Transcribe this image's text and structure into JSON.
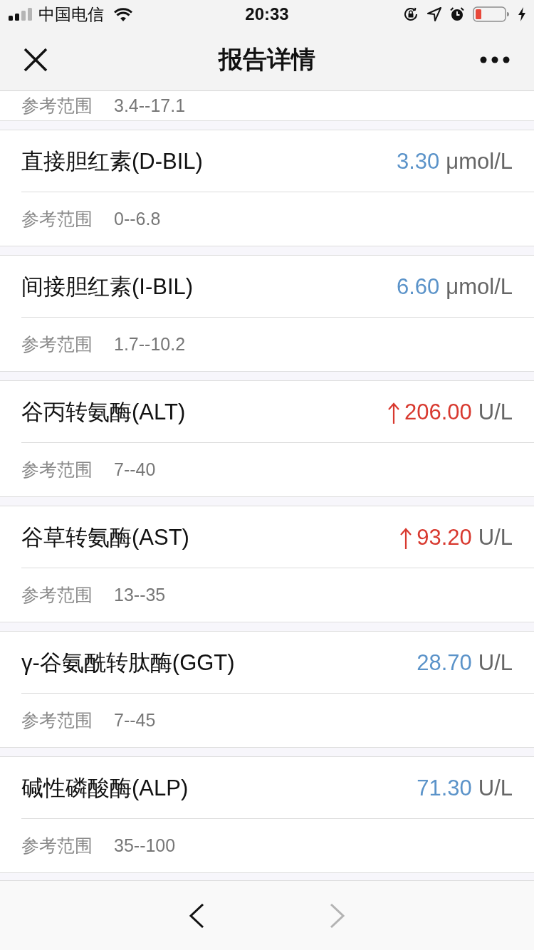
{
  "status_bar": {
    "carrier": "中国电信",
    "time": "20:33"
  },
  "nav": {
    "title": "报告详情"
  },
  "partial_item": {
    "range_label": "参考范围",
    "range": "3.4--17.1"
  },
  "items": [
    {
      "name": "直接胆红素(D-BIL)",
      "value": "3.30",
      "unit": "μmol/L",
      "high": false,
      "range_label": "参考范围",
      "range": "0--6.8"
    },
    {
      "name": "间接胆红素(I-BIL)",
      "value": "6.60",
      "unit": "μmol/L",
      "high": false,
      "range_label": "参考范围",
      "range": "1.7--10.2"
    },
    {
      "name": "谷丙转氨酶(ALT)",
      "value": "206.00",
      "unit": "U/L",
      "high": true,
      "range_label": "参考范围",
      "range": "7--40"
    },
    {
      "name": "谷草转氨酶(AST)",
      "value": "93.20",
      "unit": "U/L",
      "high": true,
      "range_label": "参考范围",
      "range": "13--35"
    },
    {
      "name": "γ-谷氨酰转肽酶(GGT)",
      "value": "28.70",
      "unit": "U/L",
      "high": false,
      "range_label": "参考范围",
      "range": "7--45"
    },
    {
      "name": "碱性磷酸酶(ALP)",
      "value": "71.30",
      "unit": "U/L",
      "high": false,
      "range_label": "参考范围",
      "range": "35--100"
    }
  ],
  "toolbar": {
    "back": {
      "disabled": false
    },
    "forward": {
      "disabled": true
    }
  }
}
